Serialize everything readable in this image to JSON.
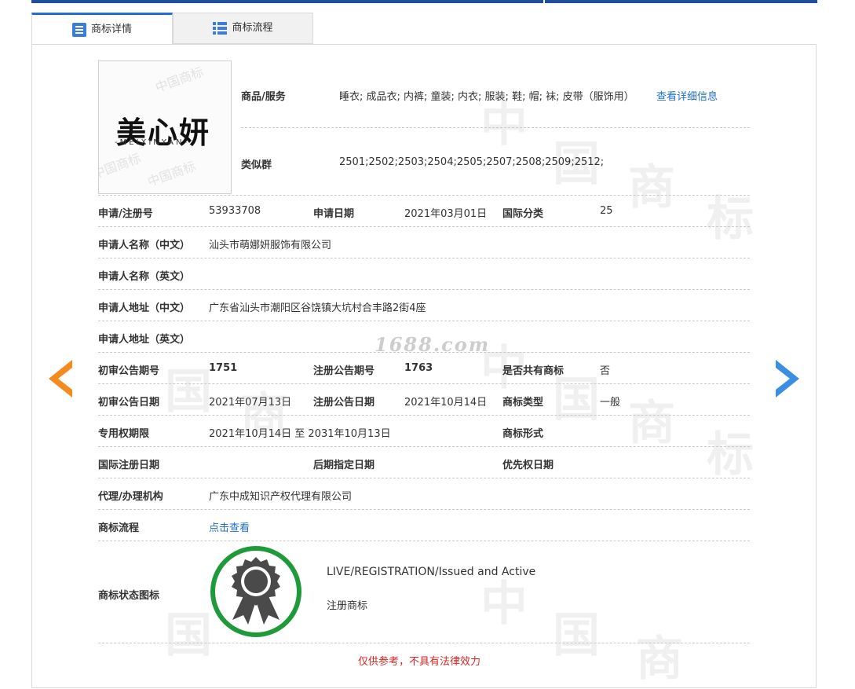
{
  "tabs": [
    {
      "label": "商标详情",
      "icon": "list-icon",
      "active": true
    },
    {
      "label": "商标流程",
      "icon": "grid-icon",
      "active": false
    }
  ],
  "logo": {
    "cn": "美心妍",
    "en": "-MEIXINYAN-",
    "watermark": "中国商标"
  },
  "goods": {
    "label": "商品/服务",
    "value": "睡衣; 成品衣; 内裤; 童装; 内衣; 服装; 鞋; 帽; 袜; 皮带（服饰用）",
    "link": "查看详细信息"
  },
  "similar": {
    "label": "类似群",
    "value": "2501;2502;2503;2504;2505;2507;2508;2509;2512;"
  },
  "fields": {
    "reg_no_label": "申请/注册号",
    "reg_no": "53933708",
    "apply_date_label": "申请日期",
    "apply_date": "2021年03月01日",
    "intl_class_label": "国际分类",
    "intl_class": "25",
    "applicant_cn_label": "申请人名称（中文）",
    "applicant_cn": "汕头市萌娜妍服饰有限公司",
    "applicant_en_label": "申请人名称（英文）",
    "address_cn_label": "申请人地址（中文）",
    "address_cn": "广东省汕头市潮阳区谷饶镇大坑村合丰路2街4座",
    "address_en_label": "申请人地址（英文）",
    "prelim_no_label": "初审公告期号",
    "prelim_no": "1751",
    "reg_pub_no_label": "注册公告期号",
    "reg_pub_no": "1763",
    "shared_label": "是否共有商标",
    "shared": "否",
    "prelim_date_label": "初审公告日期",
    "prelim_date": "2021年07月13日",
    "reg_pub_date_label": "注册公告日期",
    "reg_pub_date": "2021年10月14日",
    "tm_type_label": "商标类型",
    "tm_type": "一般",
    "validity_label": "专用权期限",
    "validity": "2021年10月14日 至 2031年10月13日",
    "tm_form_label": "商标形式",
    "intl_reg_date_label": "国际注册日期",
    "later_designation_label": "后期指定日期",
    "priority_date_label": "优先权日期",
    "agent_label": "代理/办理机构",
    "agent": "广东中成知识产权代理有限公司",
    "flow_label": "商标流程",
    "flow_link": "点击查看",
    "status_icon_label": "商标状态图标"
  },
  "status": {
    "en": "LIVE/REGISTRATION/Issued and Active",
    "cn": "注册商标",
    "badge_ring_color": "#1f9a3a"
  },
  "site_watermark": "1688.com",
  "disclaimer": "仅供参考，不具有法律效力",
  "colors": {
    "top_bar": "#1f4e9a",
    "link": "#1f6fd1",
    "arrow_prev": "#f58a1f",
    "arrow_next": "#3b8ee0",
    "disclaimer": "#dd2222"
  }
}
